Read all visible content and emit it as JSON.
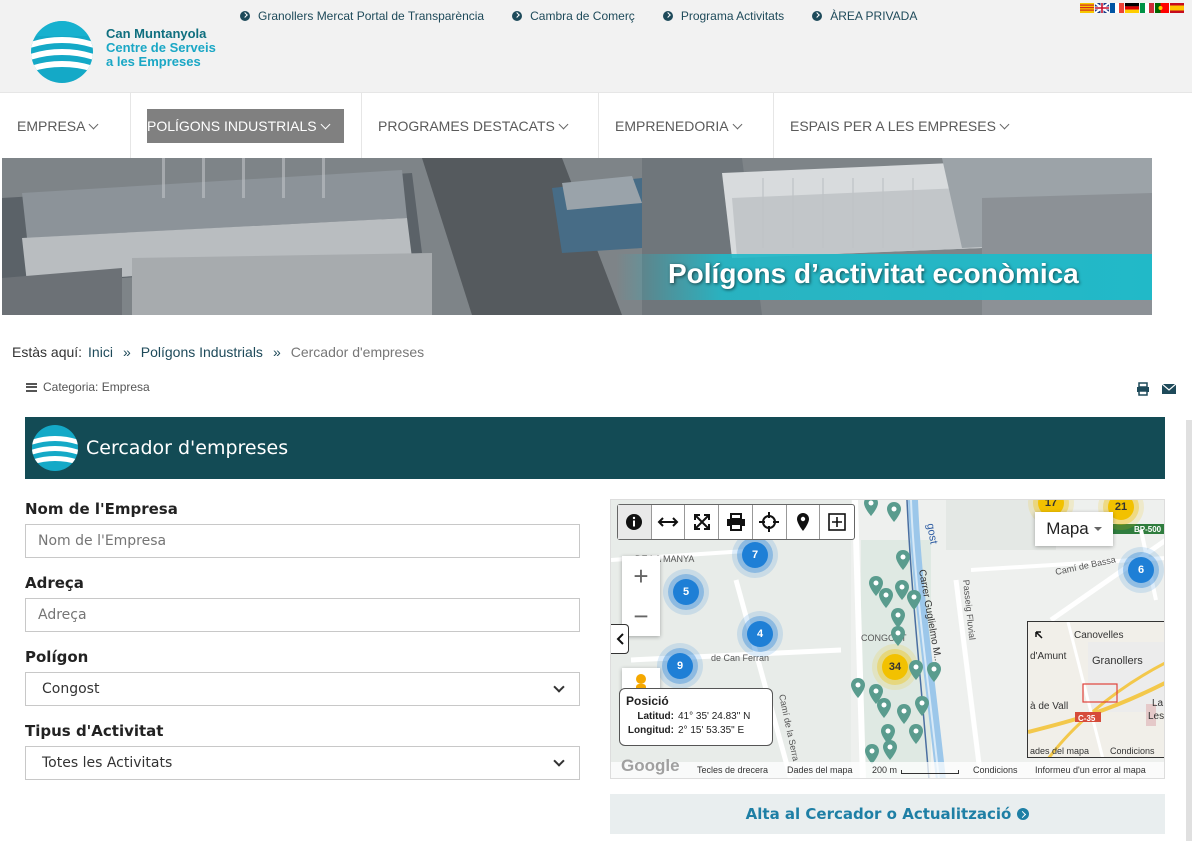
{
  "header": {
    "brand_line1": "Can Muntanyola",
    "brand_line2": "Centre de Serveis",
    "brand_line3": "a les Empreses",
    "top_links": [
      "Granollers Mercat Portal de Transparència",
      "Cambra de Comerç",
      "Programa Activitats",
      "ÀREA PRIVADA"
    ],
    "languages": [
      "catalan-flag",
      "english-flag",
      "french-flag",
      "german-flag",
      "italian-flag",
      "portuguese-flag",
      "spanish-flag"
    ]
  },
  "nav": {
    "items": [
      "EMPRESA",
      "POLÍGONS INDUSTRIALS",
      "PROGRAMES DESTACATS",
      "EMPRENEDORIA",
      "ESPAIS PER A LES EMPRESES"
    ],
    "active": "POLÍGONS INDUSTRIALS"
  },
  "banner": {
    "title": "Polígons d’activitat econòmica"
  },
  "breadcrumb": {
    "prefix": "Estàs aquí:",
    "home": "Inici",
    "section": "Polígons Industrials",
    "current": "Cercador d'empreses",
    "separator": "»"
  },
  "category": {
    "text": "Categoria: Empresa"
  },
  "page_title": "Cercador d'empreses",
  "form": {
    "name_label": "Nom de l'Empresa",
    "name_placeholder": "Nom de l'Empresa",
    "address_label": "Adreça",
    "address_placeholder": "Adreça",
    "polygon_label": "Polígon",
    "polygon_value": "Congost",
    "activity_label": "Tipus d'Activitat",
    "activity_value": "Totes les Activitats"
  },
  "map": {
    "type_button": "Mapa",
    "zoom_in": "+",
    "zoom_out": "−",
    "position_title": "Posició",
    "lat_label": "Latitud:",
    "lat_value": "41° 35' 24.83\" N",
    "lon_label": "Longitud:",
    "lon_value": "2° 15' 53.35\" E",
    "labels": {
      "manya": "DE LA MANYA",
      "can_ferran": "de Can Ferran",
      "congost": "CONGOST",
      "carrer_guglielmo": "Carrer Guglielmo M...",
      "passeig_fluvial": "Passeig Fluvial",
      "gost": "gost",
      "cami_serra": "Camí de la Serra",
      "cami_bassa": "Camí de Bassa",
      "bp500": "BP-500"
    },
    "clusters": [
      {
        "label": "7",
        "color": "blue"
      },
      {
        "label": "5",
        "color": "blue"
      },
      {
        "label": "4",
        "color": "blue"
      },
      {
        "label": "9",
        "color": "blue"
      },
      {
        "label": "6",
        "color": "blue"
      },
      {
        "label": "34",
        "color": "yellow"
      },
      {
        "label": "21",
        "color": "yellow"
      },
      {
        "label": "17",
        "color": "yellow"
      }
    ],
    "minimap": {
      "canovelles": "Canovelles",
      "granollers": "Granollers",
      "amunt": "d'Amunt",
      "vall": "à de Vall",
      "la": "La",
      "les": "Les",
      "road": "C-35",
      "footer_left": "ades del mapa",
      "footer_right": "Condicions"
    },
    "footer": {
      "google": "Google",
      "shortcuts": "Tecles de drecera",
      "mapdata": "Dades del mapa",
      "scale": "200 m",
      "terms": "Condicions",
      "report": "Informeu d'un error al mapa"
    },
    "colors": {
      "cluster_blue": "#1e7fd6",
      "cluster_yellow": "#f2c100",
      "pin": "#5a9c8e"
    }
  },
  "alta_button": "Alta al Cercador o Actualització",
  "colors": {
    "title_bar": "#134b55",
    "accent": "#1aa7c5",
    "link": "#1e4a5a"
  }
}
